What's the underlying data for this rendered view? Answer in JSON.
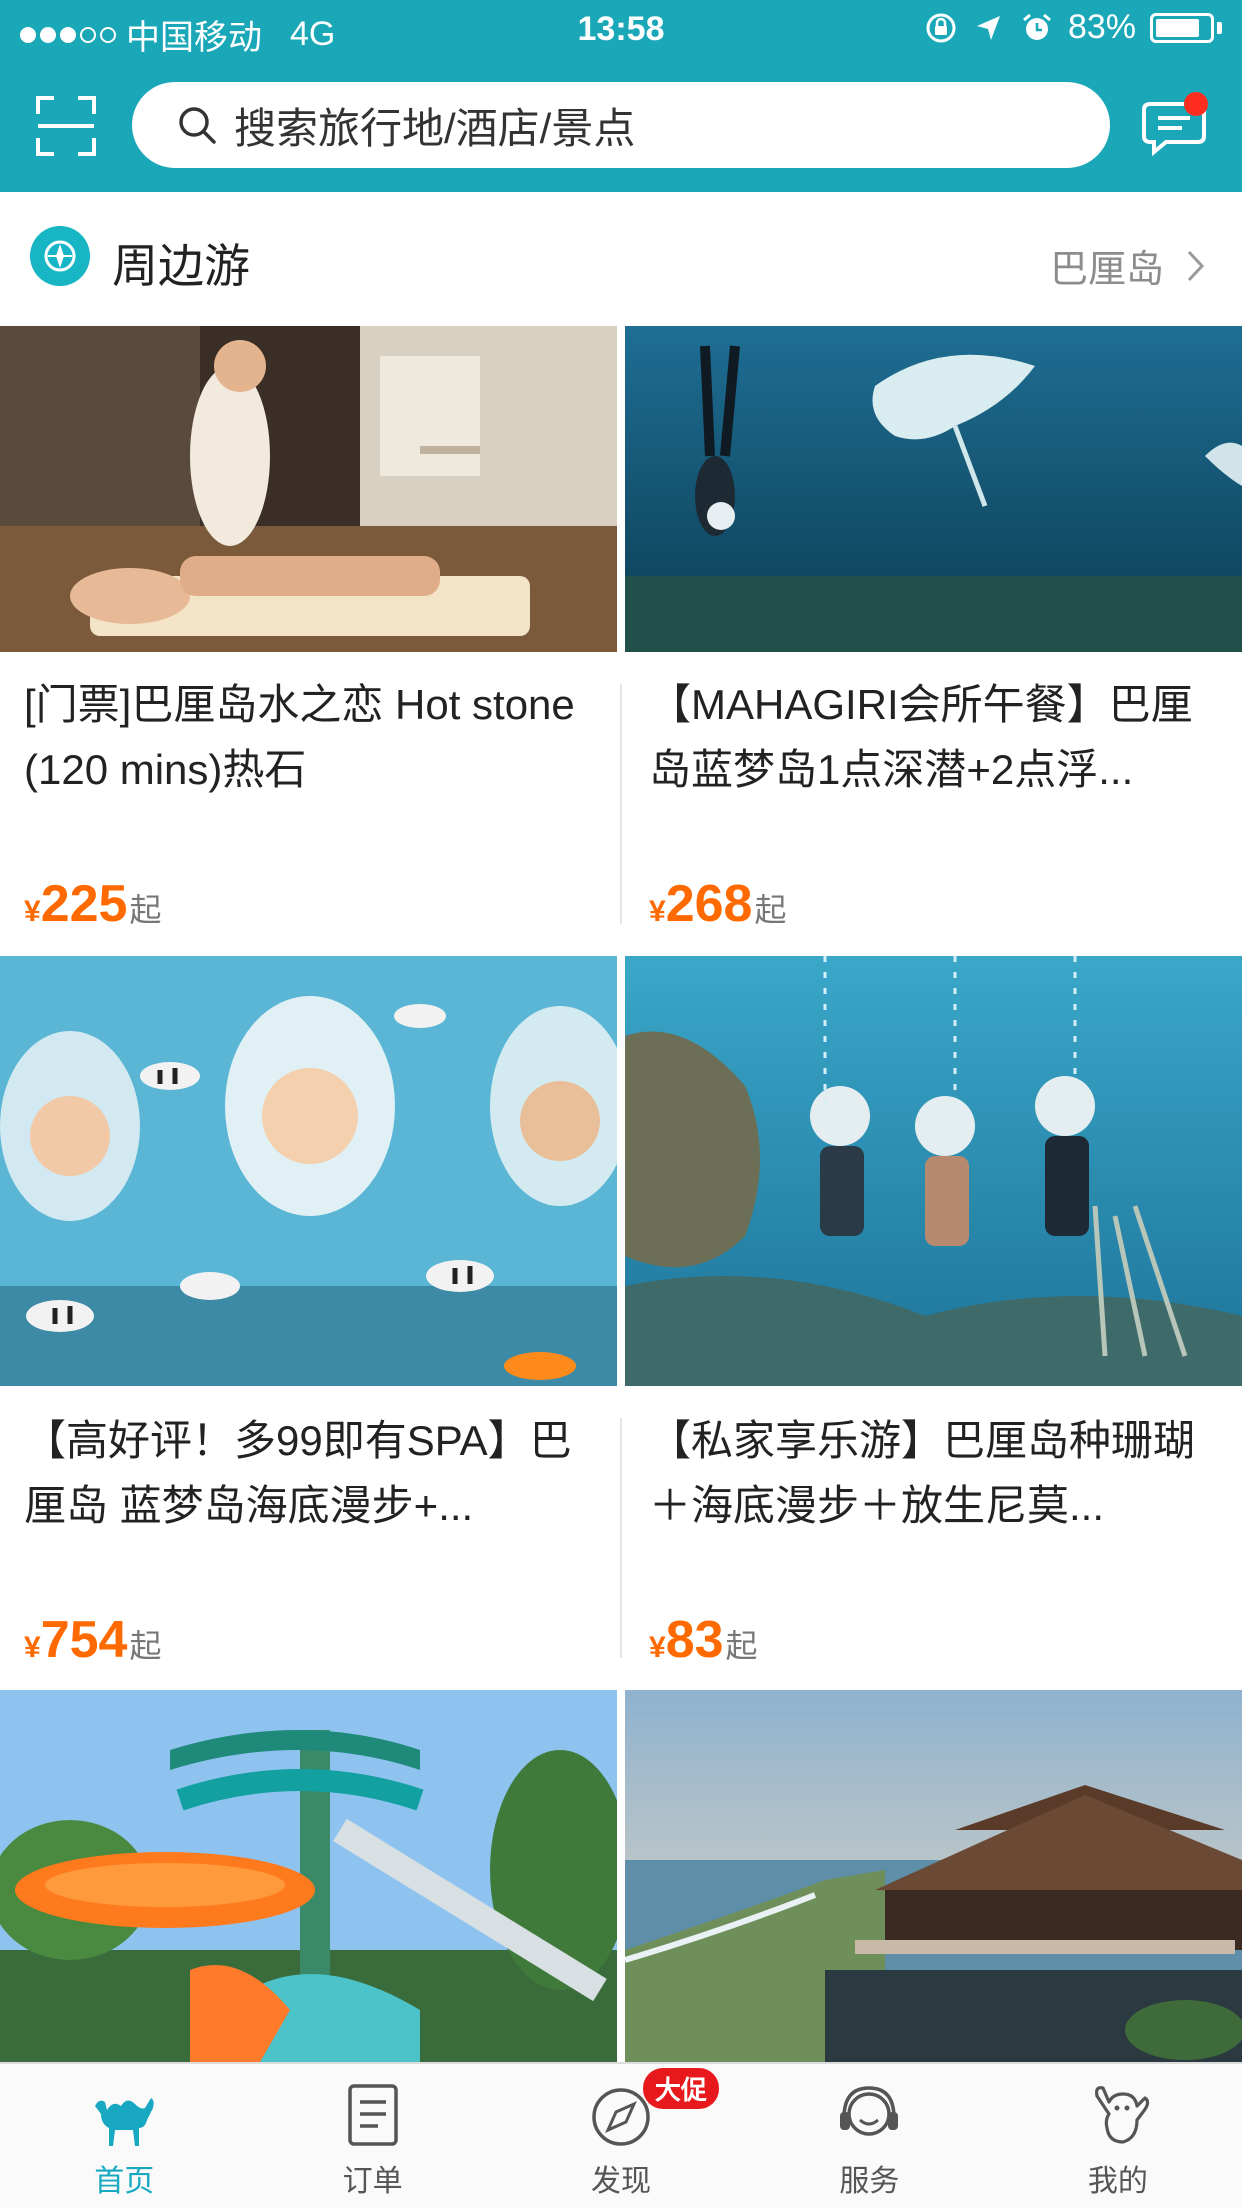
{
  "status": {
    "carrier": "中国移动",
    "network": "4G",
    "time": "13:58",
    "battery_text": "83%",
    "battery_level": 0.83
  },
  "search": {
    "placeholder": "搜索旅行地/酒店/景点"
  },
  "section": {
    "title": "周边游",
    "location": "巴厘岛"
  },
  "cards": [
    {
      "title": "[门票]巴厘岛水之恋 Hot stone (120 mins)热石",
      "currency": "¥",
      "price": "225",
      "suffix": "起"
    },
    {
      "title": "【MAHAGIRI会所午餐】巴厘岛蓝梦岛1点深潜+2点浮...",
      "currency": "¥",
      "price": "268",
      "suffix": "起"
    },
    {
      "title": "【高好评！多99即有SPA】巴厘岛 蓝梦岛海底漫步+...",
      "currency": "¥",
      "price": "754",
      "suffix": "起"
    },
    {
      "title": "【私家享乐游】巴厘岛种珊瑚＋海底漫步＋放生尼莫...",
      "currency": "¥",
      "price": "83",
      "suffix": "起"
    }
  ],
  "tabs": [
    {
      "label": "首页",
      "icon": "camel-icon",
      "active": true
    },
    {
      "label": "订单",
      "icon": "document-icon"
    },
    {
      "label": "发现",
      "icon": "compass-icon",
      "badge": "大促"
    },
    {
      "label": "服务",
      "icon": "headset-icon"
    },
    {
      "label": "我的",
      "icon": "user-icon"
    }
  ],
  "colors": {
    "brand": "#1aa8b8",
    "price": "#ff6a00",
    "active_tab": "#19a8c2",
    "badge": "#e8191c"
  }
}
